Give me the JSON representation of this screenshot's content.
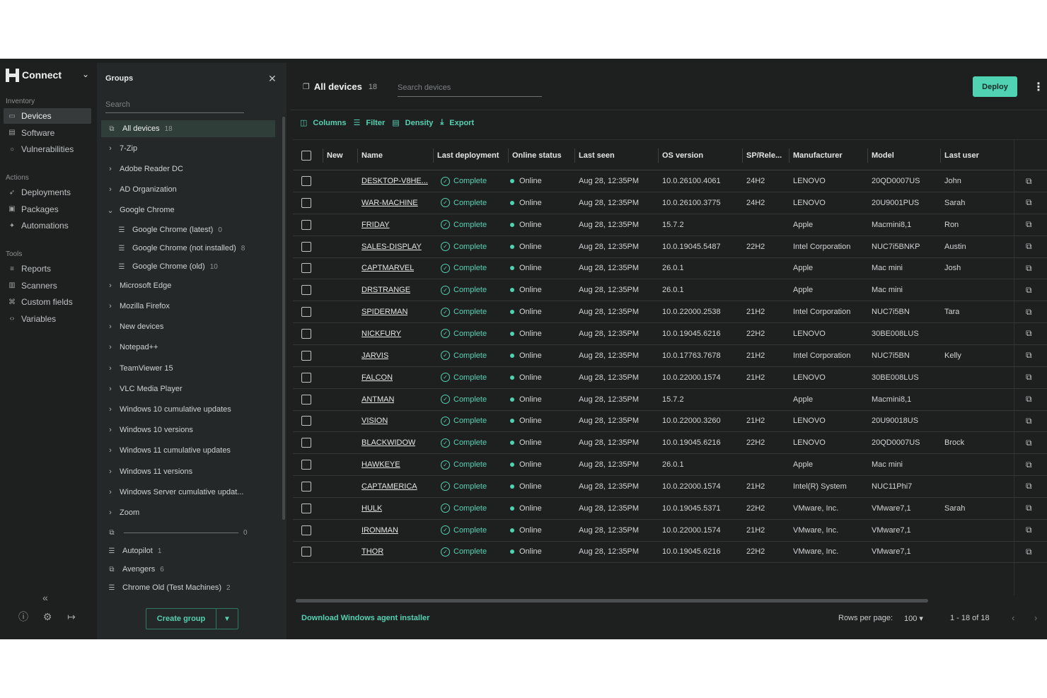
{
  "nav": {
    "brand": "Connect",
    "sections": [
      {
        "label": "Inventory",
        "items": [
          {
            "label": "Devices",
            "icon": "monitor-icon",
            "active": true
          },
          {
            "label": "Software",
            "icon": "software-icon"
          },
          {
            "label": "Vulnerabilities",
            "icon": "shield-icon"
          }
        ]
      },
      {
        "label": "Actions",
        "items": [
          {
            "label": "Deployments",
            "icon": "rocket-icon"
          },
          {
            "label": "Packages",
            "icon": "package-icon"
          },
          {
            "label": "Automations",
            "icon": "wand-icon"
          }
        ]
      },
      {
        "label": "Tools",
        "items": [
          {
            "label": "Reports",
            "icon": "reports-icon"
          },
          {
            "label": "Scanners",
            "icon": "scanner-icon"
          },
          {
            "label": "Custom fields",
            "icon": "custom-fields-icon"
          },
          {
            "label": "Variables",
            "icon": "variables-icon"
          }
        ]
      }
    ]
  },
  "groups": {
    "title": "Groups",
    "search_placeholder": "Search",
    "items": [
      {
        "label": "All devices",
        "count": "18",
        "kind": "all",
        "active": true
      },
      {
        "label": "7-Zip",
        "kind": "collapsed"
      },
      {
        "label": "Adobe Reader DC",
        "kind": "collapsed"
      },
      {
        "label": "AD Organization",
        "kind": "collapsed"
      },
      {
        "label": "Google Chrome",
        "kind": "expanded"
      },
      {
        "label": "Google Chrome (latest)",
        "count": "0",
        "kind": "filter-sub"
      },
      {
        "label": "Google Chrome (not installed)",
        "count": "8",
        "kind": "filter-sub"
      },
      {
        "label": "Google Chrome (old)",
        "count": "10",
        "kind": "filter-sub"
      },
      {
        "label": "Microsoft Edge",
        "kind": "collapsed"
      },
      {
        "label": "Mozilla Firefox",
        "kind": "collapsed"
      },
      {
        "label": "New devices",
        "kind": "collapsed"
      },
      {
        "label": "Notepad++",
        "kind": "collapsed"
      },
      {
        "label": "TeamViewer 15",
        "kind": "collapsed"
      },
      {
        "label": "VLC Media Player",
        "kind": "collapsed"
      },
      {
        "label": "Windows 10 cumulative updates",
        "kind": "collapsed"
      },
      {
        "label": "Windows 10 versions",
        "kind": "collapsed"
      },
      {
        "label": "Windows 11 cumulative updates",
        "kind": "collapsed"
      },
      {
        "label": "Windows 11 versions",
        "kind": "collapsed"
      },
      {
        "label": "Windows Server cumulative updat...",
        "kind": "collapsed"
      },
      {
        "label": "Zoom",
        "kind": "collapsed"
      },
      {
        "label": "",
        "count": "0",
        "kind": "static-blank"
      },
      {
        "label": "Autopilot",
        "count": "1",
        "kind": "filter"
      },
      {
        "label": "Avengers",
        "count": "6",
        "kind": "static"
      },
      {
        "label": "Chrome Old (Test Machines)",
        "count": "2",
        "kind": "filter"
      }
    ],
    "create_label": "Create group"
  },
  "main": {
    "title": "All devices",
    "count": "18",
    "search_placeholder": "Search devices",
    "deploy_label": "Deploy",
    "toolbar": {
      "columns": "Columns",
      "filter": "Filter",
      "density": "Density",
      "export": "Export"
    },
    "columns": [
      "New",
      "Name",
      "Last deployment",
      "Online status",
      "Last seen",
      "OS version",
      "SP/Rele...",
      "Manufacturer",
      "Model",
      "Last user"
    ],
    "rows": [
      {
        "name": "DESKTOP-V8HE...",
        "deploy": "Complete",
        "status": "Online",
        "seen": "Aug 28, 12:35PM",
        "os": "10.0.26100.4061",
        "sp": "24H2",
        "mfr": "LENOVO",
        "model": "20QD0007US",
        "user": "John"
      },
      {
        "name": "WAR-MACHINE",
        "deploy": "Complete",
        "status": "Online",
        "seen": "Aug 28, 12:35PM",
        "os": "10.0.26100.3775",
        "sp": "24H2",
        "mfr": "LENOVO",
        "model": "20U9001PUS",
        "user": "Sarah"
      },
      {
        "name": "FRIDAY",
        "deploy": "Complete",
        "status": "Online",
        "seen": "Aug 28, 12:35PM",
        "os": "15.7.2",
        "sp": "",
        "mfr": "Apple",
        "model": "Macmini8,1",
        "user": "Ron"
      },
      {
        "name": "SALES-DISPLAY",
        "deploy": "Complete",
        "status": "Online",
        "seen": "Aug 28, 12:35PM",
        "os": "10.0.19045.5487",
        "sp": "22H2",
        "mfr": "Intel Corporation",
        "model": "NUC7i5BNKP",
        "user": "Austin"
      },
      {
        "name": "CAPTMARVEL",
        "deploy": "Complete",
        "status": "Online",
        "seen": "Aug 28, 12:35PM",
        "os": "26.0.1",
        "sp": "",
        "mfr": "Apple",
        "model": "Mac mini",
        "user": "Josh"
      },
      {
        "name": "DRSTRANGE",
        "deploy": "Complete",
        "status": "Online",
        "seen": "Aug 28, 12:35PM",
        "os": "26.0.1",
        "sp": "",
        "mfr": "Apple",
        "model": "Mac mini",
        "user": ""
      },
      {
        "name": "SPIDERMAN",
        "deploy": "Complete",
        "status": "Online",
        "seen": "Aug 28, 12:35PM",
        "os": "10.0.22000.2538",
        "sp": "21H2",
        "mfr": "Intel Corporation",
        "model": "NUC7i5BN",
        "user": "Tara"
      },
      {
        "name": "NICKFURY",
        "deploy": "Complete",
        "status": "Online",
        "seen": "Aug 28, 12:35PM",
        "os": "10.0.19045.6216",
        "sp": "22H2",
        "mfr": "LENOVO",
        "model": "30BE008LUS",
        "user": ""
      },
      {
        "name": "JARVIS",
        "deploy": "Complete",
        "status": "Online",
        "seen": "Aug 28, 12:35PM",
        "os": "10.0.17763.7678",
        "sp": "21H2",
        "mfr": "Intel Corporation",
        "model": "NUC7i5BN",
        "user": "Kelly"
      },
      {
        "name": "FALCON",
        "deploy": "Complete",
        "status": "Online",
        "seen": "Aug 28, 12:35PM",
        "os": "10.0.22000.1574",
        "sp": "21H2",
        "mfr": "LENOVO",
        "model": "30BE008LUS",
        "user": ""
      },
      {
        "name": "ANTMAN",
        "deploy": "Complete",
        "status": "Online",
        "seen": "Aug 28, 12:35PM",
        "os": "15.7.2",
        "sp": "",
        "mfr": "Apple",
        "model": "Macmini8,1",
        "user": ""
      },
      {
        "name": "VISION",
        "deploy": "Complete",
        "status": "Online",
        "seen": "Aug 28, 12:35PM",
        "os": "10.0.22000.3260",
        "sp": "21H2",
        "mfr": "LENOVO",
        "model": "20U90018US",
        "user": ""
      },
      {
        "name": "BLACKWIDOW",
        "deploy": "Complete",
        "status": "Online",
        "seen": "Aug 28, 12:35PM",
        "os": "10.0.19045.6216",
        "sp": "22H2",
        "mfr": "LENOVO",
        "model": "20QD0007US",
        "user": "Brock"
      },
      {
        "name": "HAWKEYE",
        "deploy": "Complete",
        "status": "Online",
        "seen": "Aug 28, 12:35PM",
        "os": "26.0.1",
        "sp": "",
        "mfr": "Apple",
        "model": "Mac mini",
        "user": ""
      },
      {
        "name": "CAPTAMERICA",
        "deploy": "Complete",
        "status": "Online",
        "seen": "Aug 28, 12:35PM",
        "os": "10.0.22000.1574",
        "sp": "21H2",
        "mfr": "Intel(R) System",
        "model": "NUC11Phi7",
        "user": ""
      },
      {
        "name": "HULK",
        "deploy": "Complete",
        "status": "Online",
        "seen": "Aug 28, 12:35PM",
        "os": "10.0.19045.5371",
        "sp": "22H2",
        "mfr": "VMware, Inc.",
        "model": "VMware7,1",
        "user": "Sarah"
      },
      {
        "name": "IRONMAN",
        "deploy": "Complete",
        "status": "Online",
        "seen": "Aug 28, 12:35PM",
        "os": "10.0.22000.1574",
        "sp": "21H2",
        "mfr": "VMware, Inc.",
        "model": "VMware7,1",
        "user": ""
      },
      {
        "name": "THOR",
        "deploy": "Complete",
        "status": "Online",
        "seen": "Aug 28, 12:35PM",
        "os": "10.0.19045.6216",
        "sp": "22H2",
        "mfr": "VMware, Inc.",
        "model": "VMware7,1",
        "user": ""
      }
    ],
    "footer": {
      "download_label": "Download Windows agent installer",
      "rows_per_page_label": "Rows per page:",
      "rows_per_page_value": "100",
      "range": "1 - 18 of 18"
    }
  },
  "colors": {
    "accent": "#4fd3b3",
    "background": "#1e2020",
    "panel": "#252828"
  }
}
